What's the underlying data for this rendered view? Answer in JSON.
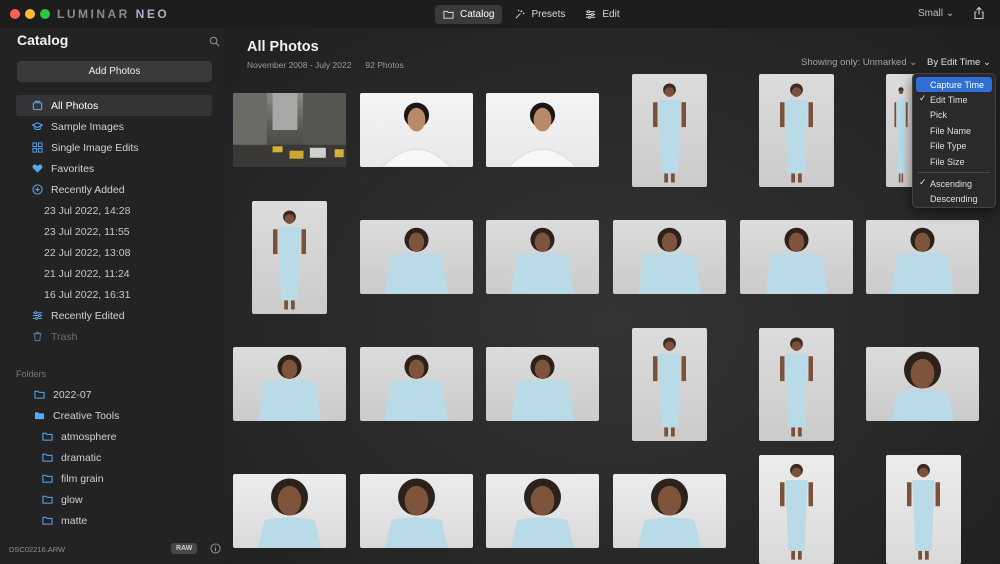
{
  "window": {
    "brand_primary": "LUMINAR",
    "brand_accent": "NEO"
  },
  "topnav": {
    "tabs": [
      {
        "label": "Catalog",
        "icon": "folder-icon",
        "active": true
      },
      {
        "label": "Presets",
        "icon": "sparkle-icon",
        "active": false
      },
      {
        "label": "Edit",
        "icon": "sliders-icon",
        "active": false
      }
    ],
    "size_label": "Small",
    "share_icon": "share-icon"
  },
  "sidebar": {
    "title": "Catalog",
    "search_icon": "search-icon",
    "add_button": "Add Photos",
    "items": [
      {
        "label": "All Photos",
        "icon": "photos-icon",
        "active": true
      },
      {
        "label": "Sample Images",
        "icon": "graduation-cap-icon"
      },
      {
        "label": "Single Image Edits",
        "icon": "grid-icon"
      },
      {
        "label": "Favorites",
        "icon": "heart-icon"
      },
      {
        "label": "Recently Added",
        "icon": "plus-circle-icon"
      },
      {
        "label": "23 Jul 2022, 14:28",
        "sub": true
      },
      {
        "label": "23 Jul 2022, 11:55",
        "sub": true
      },
      {
        "label": "22 Jul 2022, 13:08",
        "sub": true
      },
      {
        "label": "21 Jul 2022, 11:24",
        "sub": true
      },
      {
        "label": "16 Jul 2022, 16:31",
        "sub": true
      },
      {
        "label": "Recently Edited",
        "icon": "sliders-icon"
      },
      {
        "label": "Trash",
        "icon": "trash-icon",
        "disabled": true
      }
    ],
    "folders_header": "Folders",
    "folders": [
      {
        "label": "2022-07"
      },
      {
        "label": "Creative Tools",
        "open": true
      },
      {
        "label": "atmosphere",
        "sub": true
      },
      {
        "label": "dramatic",
        "sub": true
      },
      {
        "label": "film grain",
        "sub": true
      },
      {
        "label": "glow",
        "sub": true
      },
      {
        "label": "matte",
        "sub": true
      }
    ],
    "footer": {
      "filename": "DSC02216.ARW",
      "badge": "RAW",
      "info_icon": "info-icon"
    }
  },
  "main": {
    "title": "All Photos",
    "date_range": "November 2008 - July 2022",
    "count": "92 Photos",
    "filter_label": "Showing only: Unmarked",
    "sort_label": "By Edit Time"
  },
  "sort_menu": {
    "items": [
      {
        "label": "Capture Time",
        "highlighted": true,
        "checked": false
      },
      {
        "label": "Edit Time",
        "checked": true
      },
      {
        "label": "Pick",
        "checked": false
      },
      {
        "label": "File Name",
        "checked": false
      },
      {
        "label": "File Type",
        "checked": false
      },
      {
        "label": "File Size",
        "checked": false
      }
    ],
    "order_items": [
      {
        "label": "Ascending",
        "checked": true
      },
      {
        "label": "Descending",
        "checked": false
      }
    ]
  },
  "colors": {
    "accent": "#2f6fd6",
    "sidebar_icon": "#5aa9f0",
    "shirt": "#b9dbe8"
  }
}
